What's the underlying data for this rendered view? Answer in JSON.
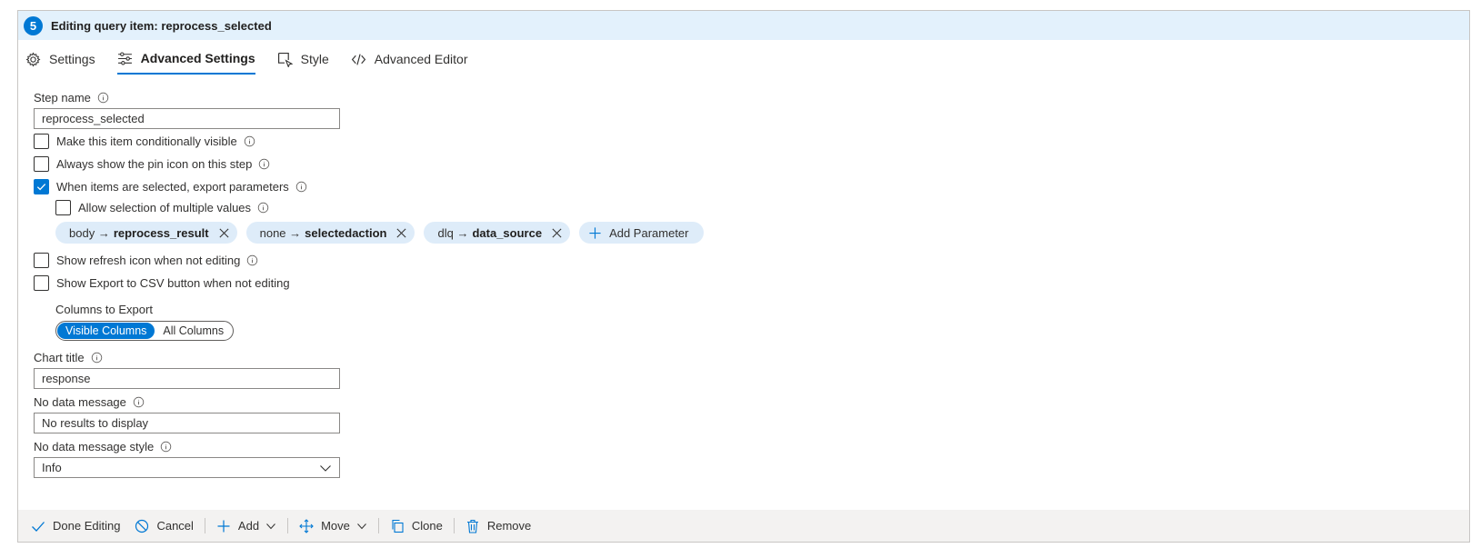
{
  "header": {
    "step_number": "5",
    "title": "Editing query item: reprocess_selected"
  },
  "tabs": [
    {
      "label": "Settings",
      "icon": "gear-icon"
    },
    {
      "label": "Advanced Settings",
      "icon": "sliders-icon",
      "active": true
    },
    {
      "label": "Style",
      "icon": "style-icon"
    },
    {
      "label": "Advanced Editor",
      "icon": "code-icon"
    }
  ],
  "form": {
    "step_name_label": "Step name",
    "step_name_value": "reprocess_selected",
    "cond_visible_label": "Make this item conditionally visible",
    "cond_visible_checked": false,
    "pin_icon_label": "Always show the pin icon on this step",
    "pin_icon_checked": false,
    "export_params_label": "When items are selected, export parameters",
    "export_params_checked": true,
    "multi_values_label": "Allow selection of multiple values",
    "multi_values_checked": false,
    "parameters": [
      {
        "field": "body",
        "arrow": "→",
        "param": "reprocess_result"
      },
      {
        "field": "none",
        "arrow": "→",
        "param": "selectedaction"
      },
      {
        "field": "dlq",
        "arrow": "→",
        "param": "data_source"
      }
    ],
    "add_parameter_label": "Add Parameter",
    "refresh_icon_label": "Show refresh icon when not editing",
    "refresh_icon_checked": false,
    "export_csv_label": "Show Export to CSV button when not editing",
    "export_csv_checked": false,
    "columns_export_label": "Columns to Export",
    "columns_options": [
      "Visible Columns",
      "All Columns"
    ],
    "columns_selected": "Visible Columns",
    "chart_title_label": "Chart title",
    "chart_title_value": "response",
    "no_data_label": "No data message",
    "no_data_value": "No results to display",
    "no_data_style_label": "No data message style",
    "no_data_style_value": "Info"
  },
  "footer": {
    "done": "Done Editing",
    "cancel": "Cancel",
    "add": "Add",
    "move": "Move",
    "clone": "Clone",
    "remove": "Remove"
  },
  "colors": {
    "accent": "#0078d4",
    "header_bg": "#e3f1fc",
    "chip_bg": "#deecf9",
    "footer_bg": "#f3f2f1"
  }
}
